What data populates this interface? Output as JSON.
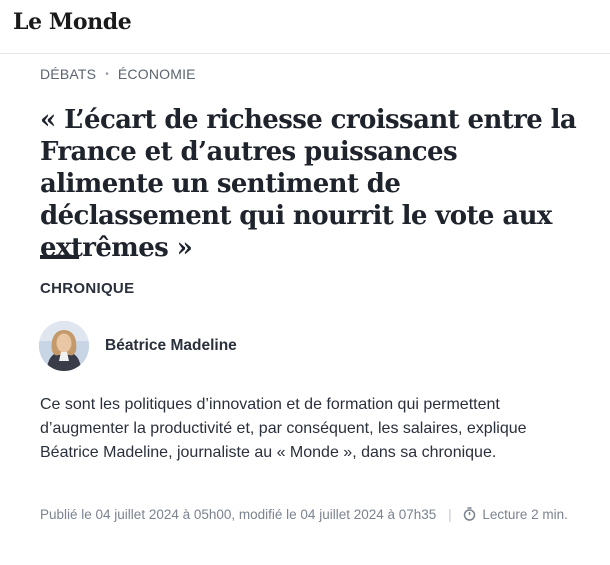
{
  "header": {
    "logo_text": "Le Monde"
  },
  "breadcrumb": {
    "items": [
      "DÉBATS",
      "ÉCONOMIE"
    ],
    "separator": "•"
  },
  "article": {
    "title": "« L’écart de richesse croissant entre la France et d’autres puissances alimente un sentiment de déclassement qui nourrit le vote aux extrêmes »",
    "kicker": "CHRONIQUE",
    "author": "Béatrice Madeline",
    "chapo": "Ce sont les politiques d’innovation et de formation qui permettent d’augmenter la productivité et, par conséquent, les salaires, explique Béatrice Madeline, journaliste au « Monde », dans sa chronique.",
    "meta": {
      "published": "Publié le 04 juillet 2024 à 05h00, modifié le 04 juillet 2024 à 07h35",
      "separator": "|",
      "reading_time": "Lecture 2 min.",
      "timer_icon": "stopwatch-icon"
    }
  },
  "colors": {
    "text": "#2a303b",
    "muted": "#7b8390",
    "divider": "#e6e6e6"
  }
}
